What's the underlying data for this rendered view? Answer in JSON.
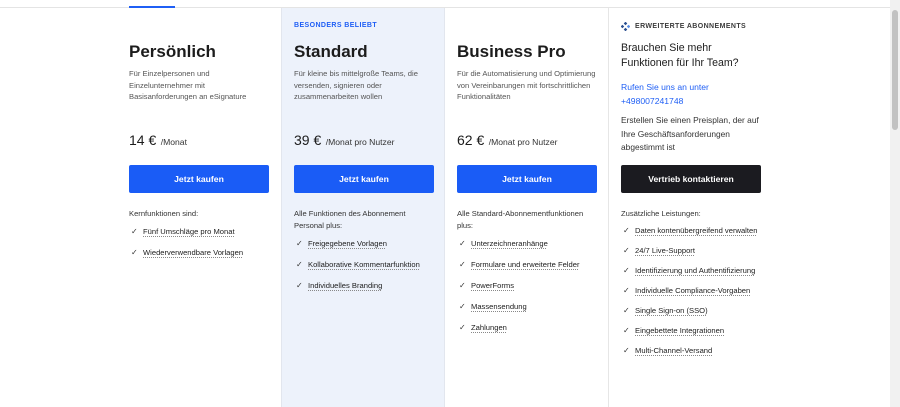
{
  "plans": [
    {
      "badge": "",
      "name": "Persönlich",
      "description": "Für Einzelpersonen und Einzelunternehmer mit Basisanforderungen an eSignature",
      "price": "14 €",
      "unit": "/Monat",
      "button": "Jetzt kaufen",
      "features_title": "Kernfunktionen sind:",
      "features": [
        "Fünf Umschläge pro Monat",
        "Wiederverwendbare Vorlagen"
      ]
    },
    {
      "badge": "BESONDERS BELIEBT",
      "name": "Standard",
      "description": "Für kleine bis mittelgroße Teams, die versenden, signieren oder zusammenarbeiten wollen",
      "price": "39 €",
      "unit": "/Monat pro Nutzer",
      "button": "Jetzt kaufen",
      "features_title": "Alle Funktionen des Abonnement Personal plus:",
      "features": [
        "Freigegebene Vorlagen",
        "Kollaborative Kommentarfunktion",
        "Individuelles Branding"
      ]
    },
    {
      "badge": "",
      "name": "Business Pro",
      "description": "Für die Automatisierung und Optimierung von Vereinbarungen mit fortschrittlichen Funktionalitäten",
      "price": "62 €",
      "unit": "/Monat pro Nutzer",
      "button": "Jetzt kaufen",
      "features_title": "Alle Standard-Abonnementfunktionen plus:",
      "features": [
        "Unterzeichneranhänge",
        "Formulare und erweiterte Felder",
        "PowerForms",
        "Massensendung",
        "Zahlungen"
      ]
    }
  ],
  "enterprise": {
    "badge": "ERWEITERTE ABONNEMENTS",
    "heading": "Brauchen Sie mehr Funktionen für Ihr Team?",
    "contact_link": "Rufen Sie uns an unter +498007241748",
    "text": "Erstellen Sie einen Preisplan, der auf Ihre Geschäftsanforderungen abgestimmt ist",
    "button": "Vertrieb kontaktieren",
    "features_title": "Zusätzliche Leistungen:",
    "features": [
      "Daten kontenübergreifend verwalten",
      "24/7 Live-Support",
      "Identifizierung und Authentifizierung",
      "Individuelle Compliance-Vorgaben",
      "Single Sign-on (SSO)",
      "Eingebettete Integrationen",
      "Multi-Channel-Versand"
    ]
  },
  "icons": {
    "check": "✓",
    "enterprise_badge": "diamond-cluster-icon"
  },
  "colors": {
    "accent": "#1a5cf6",
    "dark_button": "#1b1b20",
    "highlight_bg": "#edf2fb"
  }
}
